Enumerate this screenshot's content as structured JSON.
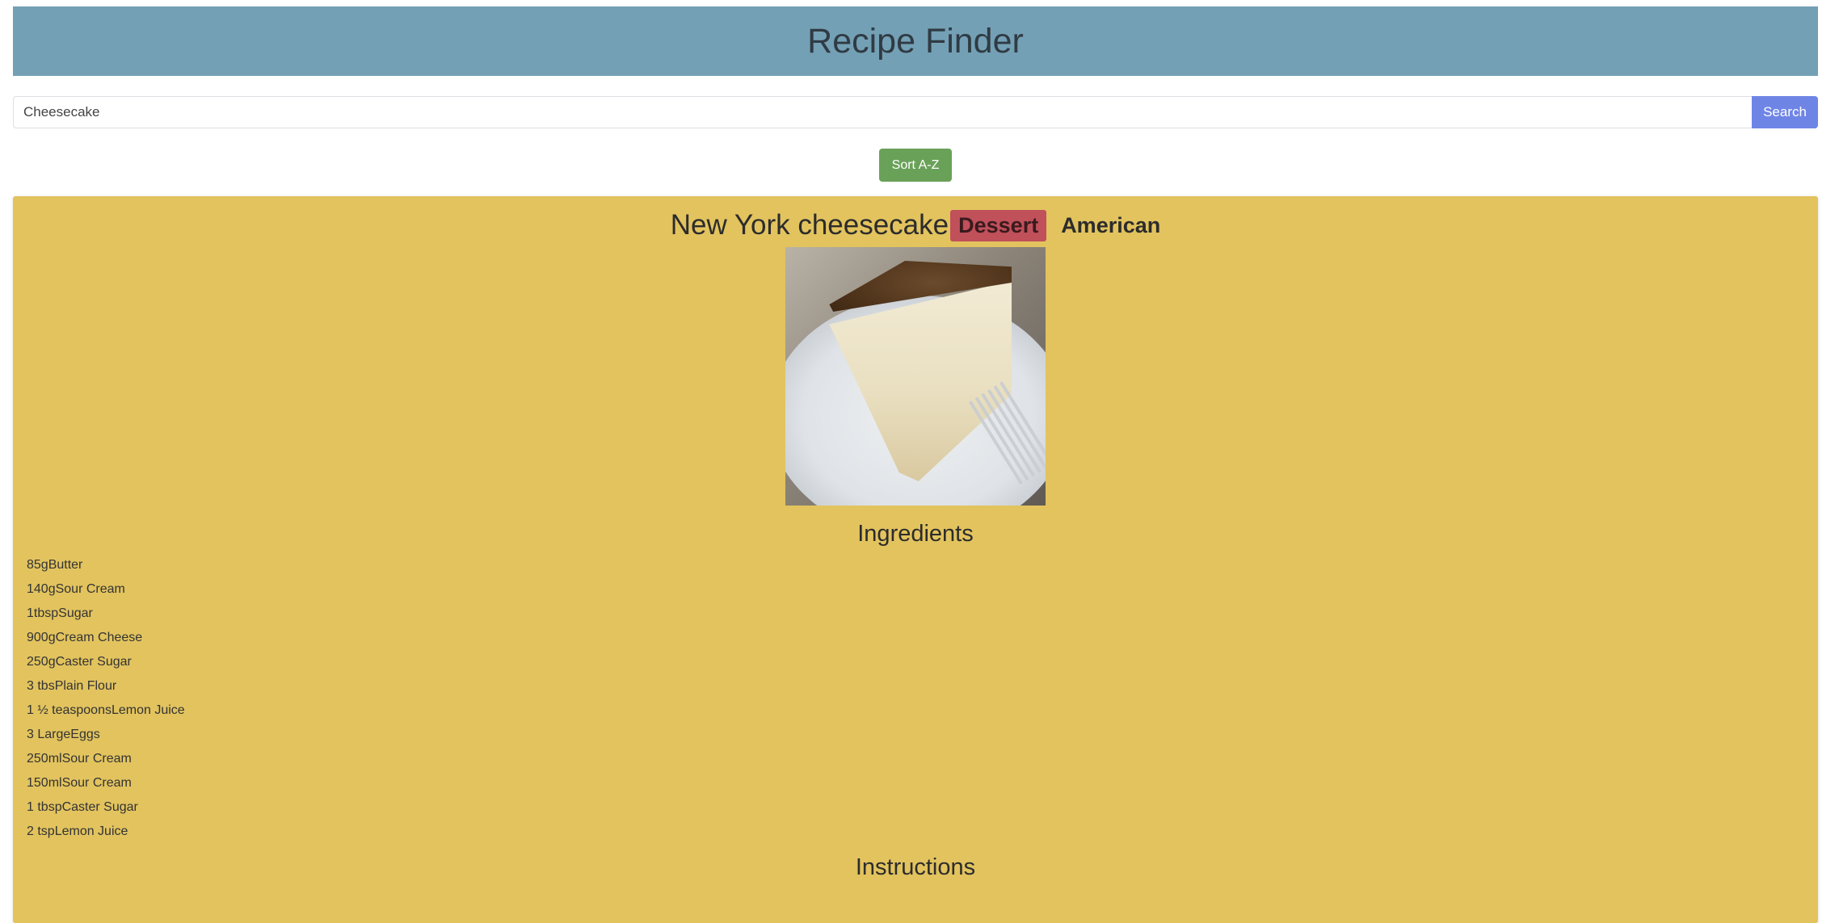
{
  "header": {
    "title": "Recipe Finder"
  },
  "search": {
    "value": "Cheesecake",
    "button_label": "Search"
  },
  "controls": {
    "sort_label": "Sort A-Z"
  },
  "recipe": {
    "title": "New York cheesecake",
    "category": "Dessert",
    "area": "American",
    "image_icon": "cheesecake-photo",
    "ingredients_heading": "Ingredients",
    "ingredients": [
      "85gButter",
      "140gSour Cream",
      "1tbspSugar",
      "900gCream Cheese",
      "250gCaster Sugar",
      "3 tbsPlain Flour",
      "1 ½ teaspoonsLemon Juice",
      "3 LargeEggs",
      "250mlSour Cream",
      "150mlSour Cream",
      "1 tbspCaster Sugar",
      "2 tspLemon Juice"
    ],
    "instructions_heading": "Instructions"
  },
  "colors": {
    "header_bg": "#74a0b5",
    "search_button": "#6f85e6",
    "sort_button": "#6aa159",
    "card_bg": "#e2c35e",
    "badge_bg": "#c0505a"
  }
}
